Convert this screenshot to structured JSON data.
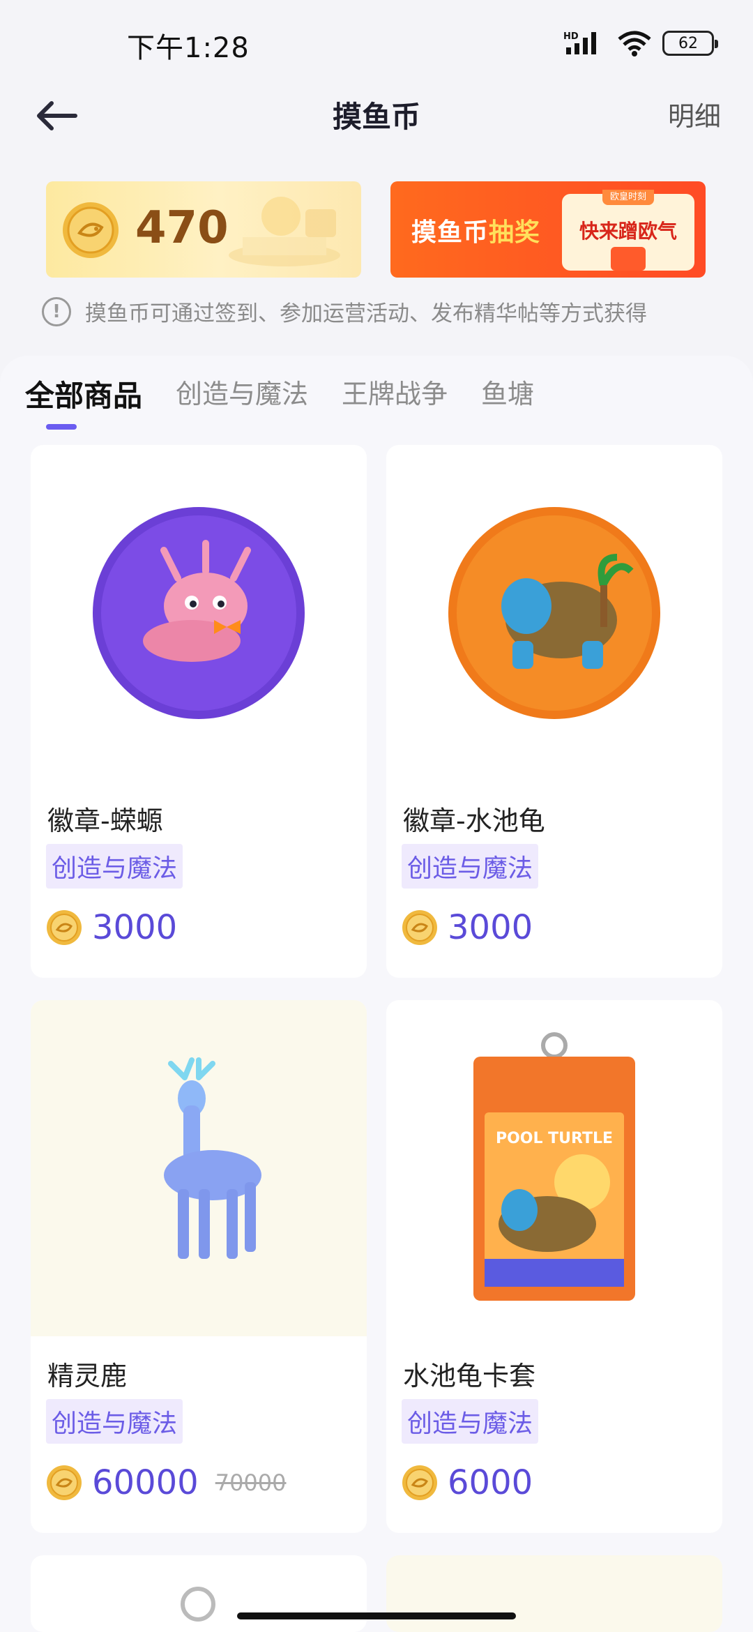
{
  "status_bar": {
    "time": "下午1:28",
    "network": "HD",
    "battery": "62"
  },
  "header": {
    "title": "摸鱼币",
    "detail_label": "明细"
  },
  "balance": {
    "value": "470"
  },
  "lottery": {
    "title_part1": "摸鱼币",
    "title_part2": "抽奖",
    "tag": "欧皇时刻",
    "cta": "快来蹭欧气"
  },
  "hint": {
    "icon": "!",
    "text": "摸鱼币可通过签到、参加运营活动、发布精华帖等方式获得"
  },
  "tabs": [
    {
      "label": "全部商品"
    },
    {
      "label": "创造与魔法"
    },
    {
      "label": "王牌战争"
    },
    {
      "label": "鱼塘"
    }
  ],
  "products": [
    {
      "name": "徽章-蝾螈",
      "tag": "创造与魔法",
      "price": "3000",
      "image_icon": "axolotl-badge-icon"
    },
    {
      "name": "徽章-水池龟",
      "tag": "创造与魔法",
      "price": "3000",
      "image_icon": "turtle-badge-icon"
    },
    {
      "name": "精灵鹿",
      "tag": "创造与魔法",
      "price": "60000",
      "old_price": "70000",
      "image_icon": "spirit-deer-icon"
    },
    {
      "name": "水池龟卡套",
      "tag": "创造与魔法",
      "price": "6000",
      "image_icon": "card-holder-icon",
      "image_text": "POOL TURTLE"
    }
  ],
  "colors": {
    "accent": "#6a5cf0",
    "price": "#5a4ad8",
    "tag_bg": "#efeafd",
    "lottery": "#ff5326",
    "coin": "#f2c14a"
  }
}
